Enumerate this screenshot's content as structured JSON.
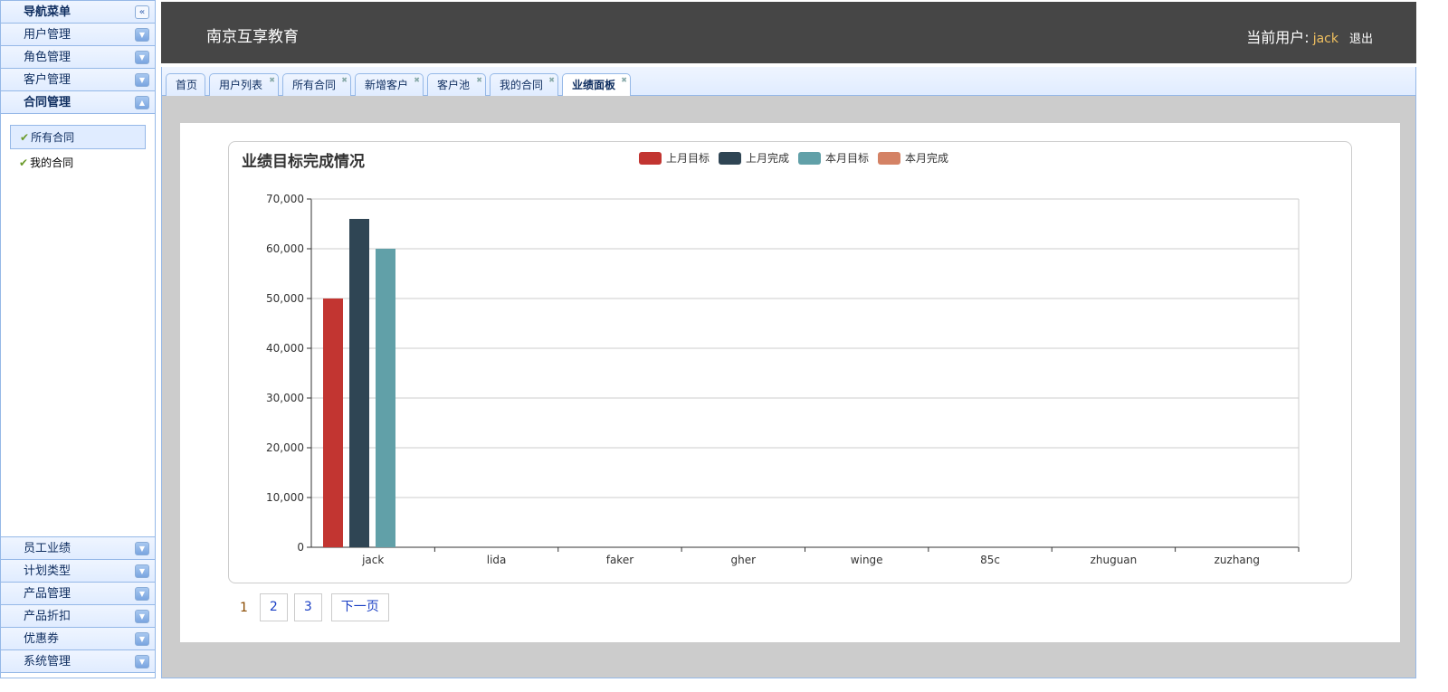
{
  "sidebar": {
    "title": "导航菜单",
    "panels_top": [
      {
        "label": "用户管理"
      },
      {
        "label": "角色管理"
      },
      {
        "label": "客户管理"
      }
    ],
    "open_panel": {
      "label": "合同管理",
      "items": [
        {
          "label": "所有合同",
          "selected": true
        },
        {
          "label": "我的合同",
          "selected": false
        }
      ]
    },
    "panels_bottom": [
      {
        "label": "员工业绩"
      },
      {
        "label": "计划类型"
      },
      {
        "label": "产品管理"
      },
      {
        "label": "产品折扣"
      },
      {
        "label": "优惠券"
      },
      {
        "label": "系统管理"
      }
    ]
  },
  "header": {
    "brand": "南京互享教育",
    "user_label": "当前用户:",
    "user_name": "jack",
    "logout": "退出"
  },
  "tabs": [
    {
      "label": "首页",
      "closable": false
    },
    {
      "label": "用户列表",
      "closable": true
    },
    {
      "label": "所有合同",
      "closable": true
    },
    {
      "label": "新增客户",
      "closable": true
    },
    {
      "label": "客户池",
      "closable": true
    },
    {
      "label": "我的合同",
      "closable": true
    },
    {
      "label": "业绩面板",
      "closable": true,
      "active": true
    }
  ],
  "chart_data": {
    "type": "bar",
    "title": "业绩目标完成情况",
    "categories": [
      "jack",
      "lida",
      "faker",
      "gher",
      "winge",
      "85c",
      "zhuguan",
      "zuzhang"
    ],
    "series": [
      {
        "name": "上月目标",
        "color": "#c23531",
        "values": [
          50000,
          0,
          0,
          0,
          0,
          0,
          0,
          0
        ]
      },
      {
        "name": "上月完成",
        "color": "#2f4554",
        "values": [
          66000,
          0,
          0,
          0,
          0,
          0,
          0,
          0
        ]
      },
      {
        "name": "本月目标",
        "color": "#61a0a8",
        "values": [
          60000,
          0,
          0,
          0,
          0,
          0,
          0,
          0
        ]
      },
      {
        "name": "本月完成",
        "color": "#d48265",
        "values": [
          0,
          0,
          0,
          0,
          0,
          0,
          0,
          0
        ]
      }
    ],
    "ylim": [
      0,
      70000
    ],
    "yticks": [
      "0",
      "10,000",
      "20,000",
      "30,000",
      "40,000",
      "50,000",
      "60,000",
      "70,000"
    ],
    "legend_position": "top-center",
    "grid": true
  },
  "pager": {
    "current": "1",
    "pages": [
      "2",
      "3"
    ],
    "next": "下一页"
  }
}
